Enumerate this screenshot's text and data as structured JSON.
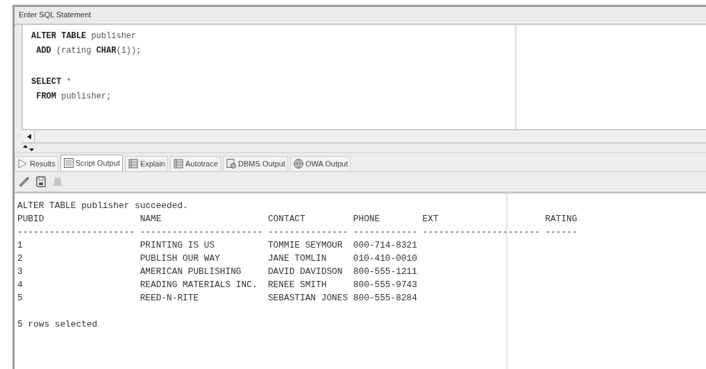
{
  "editor": {
    "title": "Enter SQL Statement",
    "statements": [
      [
        "**ALTER TABLE** publisher",
        " **ADD** (rating **CHAR**(1));"
      ],
      [
        "**SELECT** *",
        " **FROM** publisher;"
      ]
    ]
  },
  "tabs": [
    {
      "label": "Results",
      "kind": "play",
      "selected": false
    },
    {
      "label": "Script Output",
      "kind": "script",
      "selected": true
    },
    {
      "label": "Explain",
      "kind": "plan",
      "selected": false
    },
    {
      "label": "Autotrace",
      "kind": "plan",
      "selected": false
    },
    {
      "label": "DBMS Output",
      "kind": "dbms",
      "selected": false
    },
    {
      "label": "OWA Output",
      "kind": "globe",
      "selected": false
    }
  ],
  "toolbar": [
    {
      "kind": "eraser",
      "disabled": false
    },
    {
      "kind": "save",
      "disabled": false
    },
    {
      "kind": "print",
      "disabled": true
    }
  ],
  "output": {
    "message": "ALTER TABLE publisher succeeded.",
    "columns": [
      {
        "heading": "PUBID",
        "rule": "----------------------"
      },
      {
        "heading": "NAME",
        "rule": "-----------------------"
      },
      {
        "heading": "CONTACT",
        "rule": "---------------"
      },
      {
        "heading": "PHONE",
        "rule": "------------"
      },
      {
        "heading": "EXT",
        "rule": "----------------------"
      },
      {
        "heading": "RATING",
        "rule": "------"
      }
    ],
    "rows": [
      [
        "1",
        "PRINTING IS US",
        "TOMMIE SEYMOUR",
        "000-714-8321"
      ],
      [
        "2",
        "PUBLISH OUR WAY",
        "JANE TOMLIN",
        "010-410-0010"
      ],
      [
        "3",
        "AMERICAN PUBLISHING",
        "DAVID DAVIDSON",
        "800-555-1211"
      ],
      [
        "4",
        "READING MATERIALS INC.",
        "RENEE SMITH",
        "800-555-9743"
      ],
      [
        "5",
        "REED-N-RITE",
        "SEBASTIAN JONES",
        "800-555-8284"
      ]
    ],
    "footer": "5 rows selected"
  }
}
